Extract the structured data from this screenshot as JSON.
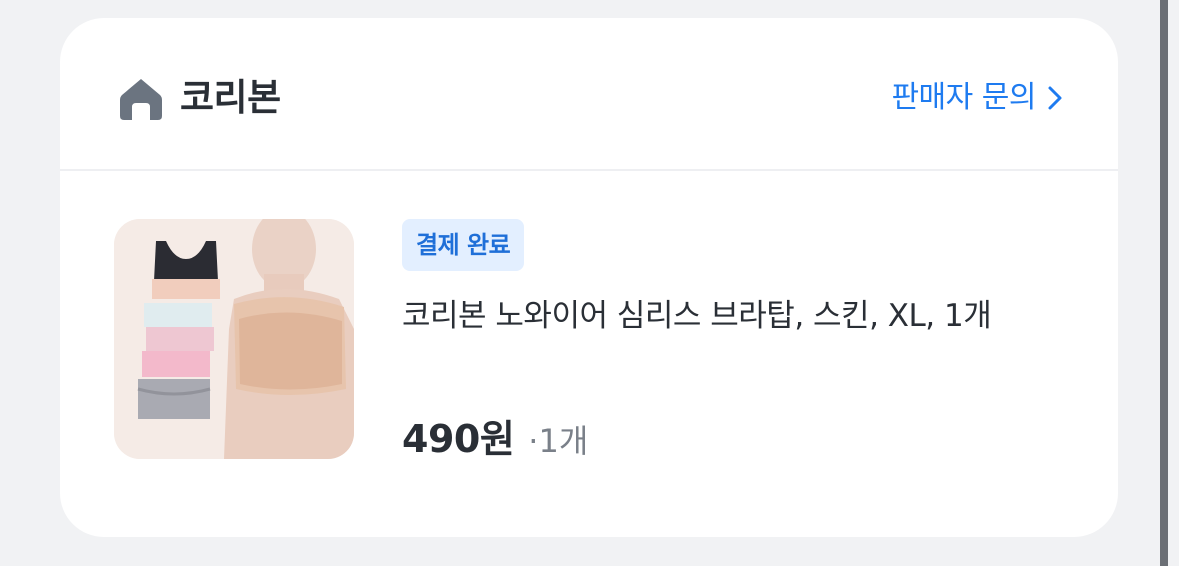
{
  "seller": {
    "name": "코리본",
    "icon": "home-icon",
    "inquiry_label": "판매자 문의",
    "inquiry_icon": "chevron-right-icon"
  },
  "order_item": {
    "status": "결제 완료",
    "title": "코리본 노와이어 심리스 브라탑, 스킨, XL, 1개",
    "price": "490원",
    "quantity": "·1개",
    "image": "product-thumbnail"
  },
  "colors": {
    "accent": "#1e7bf0",
    "badge_bg": "#e3efff",
    "badge_text": "#1f6fd8",
    "text_primary": "#2a2f36",
    "text_secondary": "#7a8089",
    "page_bg": "#f1f2f4"
  }
}
